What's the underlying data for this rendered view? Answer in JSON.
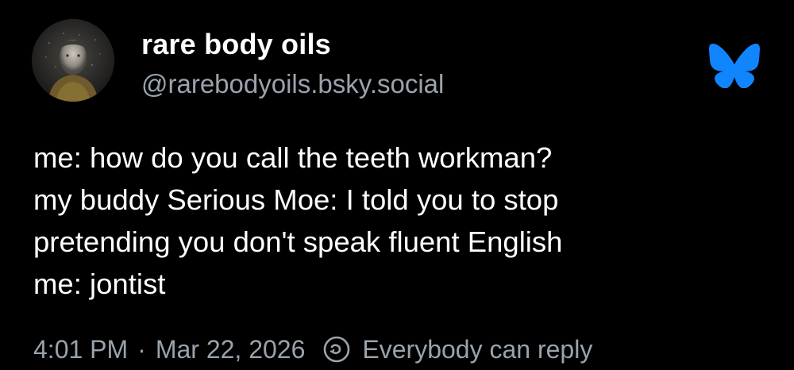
{
  "post": {
    "author": {
      "display_name": "rare body oils",
      "handle": "@rarebodyoils.bsky.social",
      "avatar_icon": "avatar-image"
    },
    "platform_icon": "bluesky-butterfly-icon",
    "brand_color": "#1185fe",
    "text_lines": [
      "me: how do you call the teeth workman?",
      "my buddy Serious Moe: I told you to stop",
      "pretending you don't speak fluent English",
      "me: jontist"
    ],
    "meta": {
      "time": "4:01 PM",
      "separator": "·",
      "date": "Mar 22, 2026",
      "reply_setting_icon": "everybody-can-reply-icon",
      "reply_setting": "Everybody can reply"
    }
  }
}
